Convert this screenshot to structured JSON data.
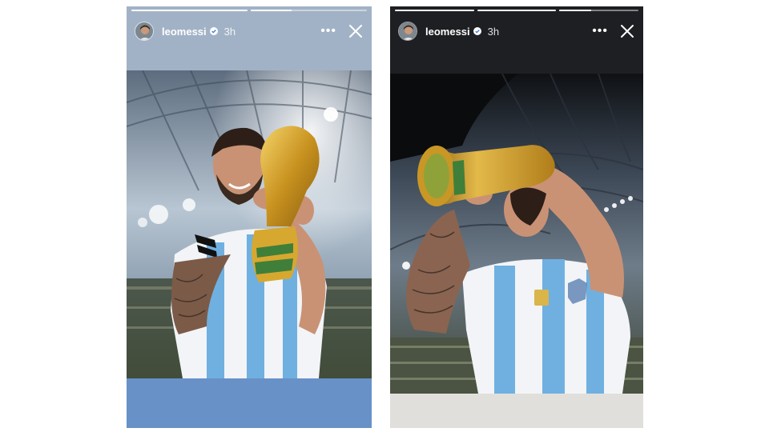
{
  "stories": [
    {
      "username": "leomessi",
      "time": "3h",
      "verified": true,
      "progress_segments": [
        1,
        0.35
      ],
      "background_top": "#a2b2c6",
      "background_bottom": "#6891c7",
      "photo_description_icon": "trophy-celebration-photo"
    },
    {
      "username": "leomessi",
      "time": "3h",
      "verified": true,
      "progress_segments": [
        1,
        1,
        0.4
      ],
      "background_top": "#1d1f22",
      "background_bottom": "#e1dfdb",
      "photo_description_icon": "trophy-kiss-photo"
    }
  ],
  "icons": {
    "more": "more-options-icon",
    "close": "close-icon",
    "verified": "verified-badge-icon"
  },
  "colors": {
    "jersey_blue": "#6fb0e0",
    "trophy_gold": "#d4a62a",
    "verified_blue": "#ffffff"
  }
}
